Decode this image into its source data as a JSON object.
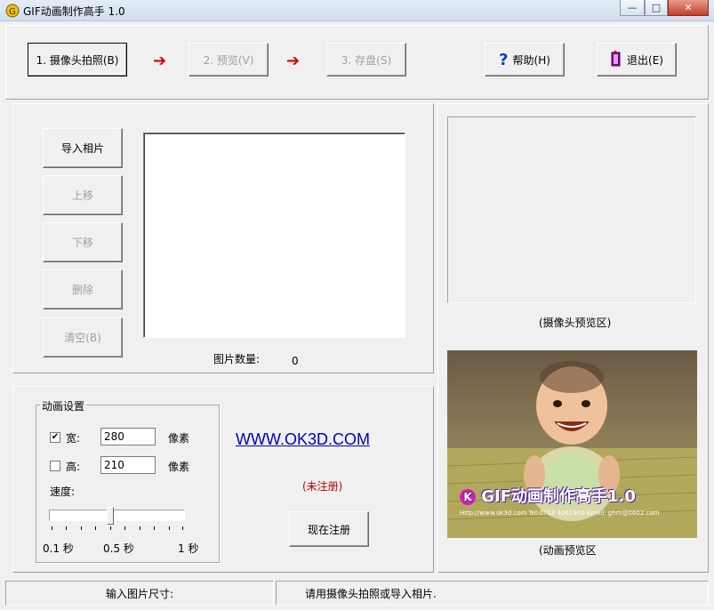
{
  "window": {
    "title": "GIF动画制作高手 1.0",
    "minimize": "—",
    "maximize": "□",
    "close": "✕"
  },
  "toolbar": {
    "step1": "1. 摄像头拍照(B)",
    "step2": "2. 预览(V)",
    "step3": "3. 存盘(S)",
    "arrow": "➔",
    "help_label": "帮助(H)",
    "exit_label": "退出(E)"
  },
  "image_panel": {
    "import_btn": "导入相片",
    "move_up_btn": "上移",
    "move_down_btn": "下移",
    "delete_btn": "删除",
    "clear_btn": "清空(B)",
    "count_label": "图片数量:",
    "count_value": "0"
  },
  "camera_preview": {
    "caption": "(摄像头预览区)"
  },
  "animation_settings": {
    "group_title": "动画设置",
    "width_checked": true,
    "width_label": "宽:",
    "width_value": "280",
    "width_unit": "像素",
    "height_checked": false,
    "height_label": "高:",
    "height_value": "210",
    "height_unit": "像素",
    "speed_label": "速度:",
    "speed_position": 0.45,
    "speed_min": "0.1 秒",
    "speed_mid": "0.5 秒",
    "speed_max": "1 秒"
  },
  "promo": {
    "website": "WWW.OK3D.COM",
    "unregistered": "(未注册)",
    "register_btn": "现在注册"
  },
  "animation_preview": {
    "caption": "(动画预览区",
    "overlay_title": "GIF动画制作高手1.0",
    "overlay_contact": "Http://www.ok3d.com Tel:0713 4061900 Email: ghm@0602.com"
  },
  "status_bar": {
    "left": "输入图片尺寸:",
    "right": "请用摄像头拍照或导入相片."
  },
  "colors": {
    "link": "#0000c0",
    "unregistered": "#c00000",
    "arrow": "#d40000"
  }
}
